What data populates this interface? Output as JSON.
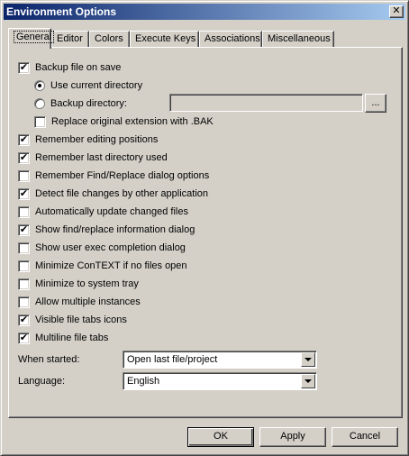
{
  "window": {
    "title": "Environment Options",
    "close_glyph": "✕"
  },
  "tabs": [
    {
      "label": "General",
      "active": true
    },
    {
      "label": "Editor"
    },
    {
      "label": "Colors"
    },
    {
      "label": "Execute Keys"
    },
    {
      "label": "Associations"
    },
    {
      "label": "Miscellaneous"
    }
  ],
  "general": {
    "backup_on_save": {
      "label": "Backup file on save",
      "checked": true
    },
    "use_current_directory": {
      "label": "Use current directory",
      "selected": true
    },
    "backup_directory": {
      "label": "Backup directory:",
      "selected": false,
      "value": ""
    },
    "browse_label": "...",
    "replace_ext": {
      "label": "Replace original extension with .BAK",
      "checked": false
    },
    "options": [
      {
        "label": "Remember editing positions",
        "checked": true
      },
      {
        "label": "Remember last directory used",
        "checked": true
      },
      {
        "label": "Remember Find/Replace dialog options",
        "checked": false
      },
      {
        "label": "Detect file changes by other application",
        "checked": true
      },
      {
        "label": "Automatically update changed files",
        "checked": false
      },
      {
        "label": "Show find/replace information dialog",
        "checked": true
      },
      {
        "label": "Show user exec completion dialog",
        "checked": false
      },
      {
        "label": "Minimize ConTEXT if no files open",
        "checked": false
      },
      {
        "label": "Minimize to system tray",
        "checked": false
      },
      {
        "label": "Allow multiple instances",
        "checked": false
      },
      {
        "label": "Visible file tabs icons",
        "checked": true
      },
      {
        "label": "Multiline file tabs",
        "checked": true
      }
    ],
    "when_started": {
      "label": "When started:",
      "value": "Open last file/project"
    },
    "language": {
      "label": "Language:",
      "value": "English"
    }
  },
  "buttons": {
    "ok": "OK",
    "apply": "Apply",
    "cancel": "Cancel"
  },
  "check_glyph": "✔"
}
